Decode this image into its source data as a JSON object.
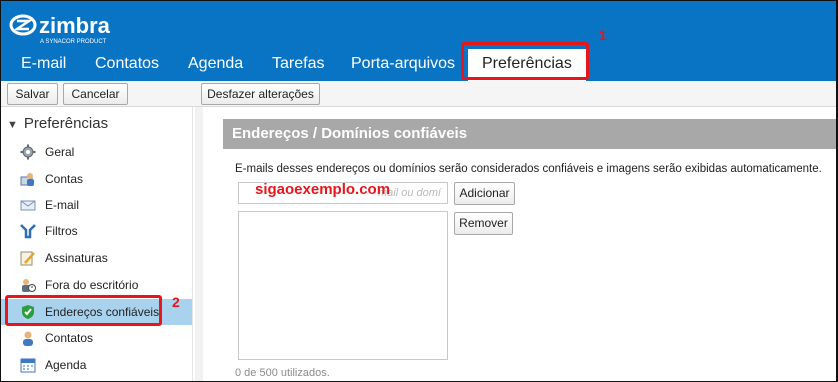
{
  "app": {
    "logo_text": "zimbra",
    "logo_subtext": "A SYNACOR PRODUCT",
    "brand_color": "#0a74c4",
    "callout_color": "#e8151b"
  },
  "tabs": [
    {
      "label": "E-mail",
      "icon": "none"
    },
    {
      "label": "Contatos"
    },
    {
      "label": "Agenda"
    },
    {
      "label": "Tarefas"
    },
    {
      "label": "Porta-arquivos"
    },
    {
      "label": "Preferências",
      "active": true
    }
  ],
  "toolbar": {
    "save_label": "Salvar",
    "cancel_label": "Cancelar",
    "undo_label": "Desfazer alterações"
  },
  "sidebar": {
    "heading": "Preferências",
    "items": [
      {
        "label": "Geral",
        "icon": "gear-icon"
      },
      {
        "label": "Contas",
        "icon": "accounts-icon"
      },
      {
        "label": "E-mail",
        "icon": "envelope-icon"
      },
      {
        "label": "Filtros",
        "icon": "filter-icon"
      },
      {
        "label": "Assinaturas",
        "icon": "signature-icon"
      },
      {
        "label": "Fora do escritório",
        "icon": "out-of-office-icon"
      },
      {
        "label": "Endereços confiáveis",
        "icon": "shield-check-icon",
        "selected": true
      },
      {
        "label": "Contatos",
        "icon": "contact-icon"
      },
      {
        "label": "Agenda",
        "icon": "calendar-icon"
      }
    ]
  },
  "main": {
    "section_title": "Endereços / Domínios confiáveis",
    "description": "E-mails desses endereços ou domínios serão considerados confiáveis e imagens serão exibidas automaticamente.",
    "input_placeholder": "mail ou domí",
    "input_overlay_text": "sigaoexemplo.com",
    "add_label": "Adicionar",
    "remove_label": "Remover",
    "usage_text": "0 de 500 utilizados."
  },
  "annotations": [
    {
      "number": "1"
    },
    {
      "number": "2"
    }
  ]
}
